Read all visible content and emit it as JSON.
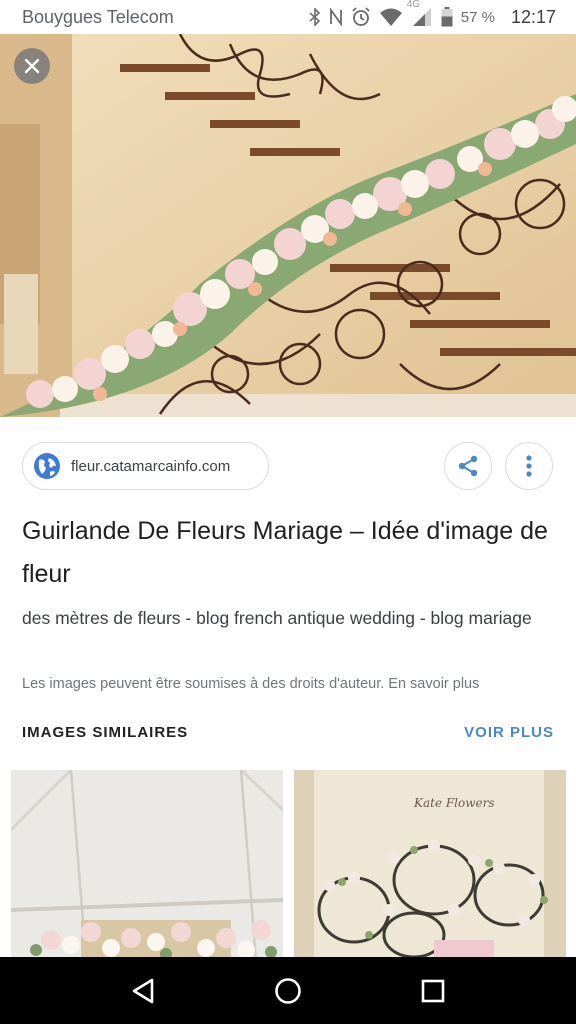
{
  "status_bar": {
    "carrier": "Bouygues Telecom",
    "network": "4G",
    "battery_percent": "57 %",
    "time": "12:17",
    "icons": [
      "bluetooth-icon",
      "nfc-icon",
      "alarm-icon",
      "wifi-icon",
      "signal-icon",
      "battery-icon"
    ]
  },
  "viewer": {
    "close_icon": "close-icon"
  },
  "source": {
    "domain": "fleur.catamarcainfo.com",
    "icon": "globe-icon"
  },
  "actions": {
    "share_icon": "share-icon",
    "more_icon": "more-vert-icon"
  },
  "result": {
    "title": "Guirlande De Fleurs Mariage – Idée d'image de fleur",
    "description": "des mètres de fleurs - blog french antique wedding - blog mariage",
    "copyright_notice": "Les images peuvent être soumises à des droits d'auteur.",
    "learn_more": "En savoir plus"
  },
  "similar": {
    "header": "IMAGES SIMILAIRES",
    "see_more": "VOIR PLUS",
    "thumbnails": [
      {
        "brand_text": ""
      },
      {
        "brand_text": "Kate Flowers"
      }
    ]
  },
  "navigation": {
    "buttons": [
      "back-icon",
      "home-icon",
      "recents-icon"
    ]
  },
  "colors": {
    "accent": "#4a87c8",
    "text_primary": "#202124",
    "text_secondary": "#70757a",
    "nav_bar": "#000000"
  }
}
